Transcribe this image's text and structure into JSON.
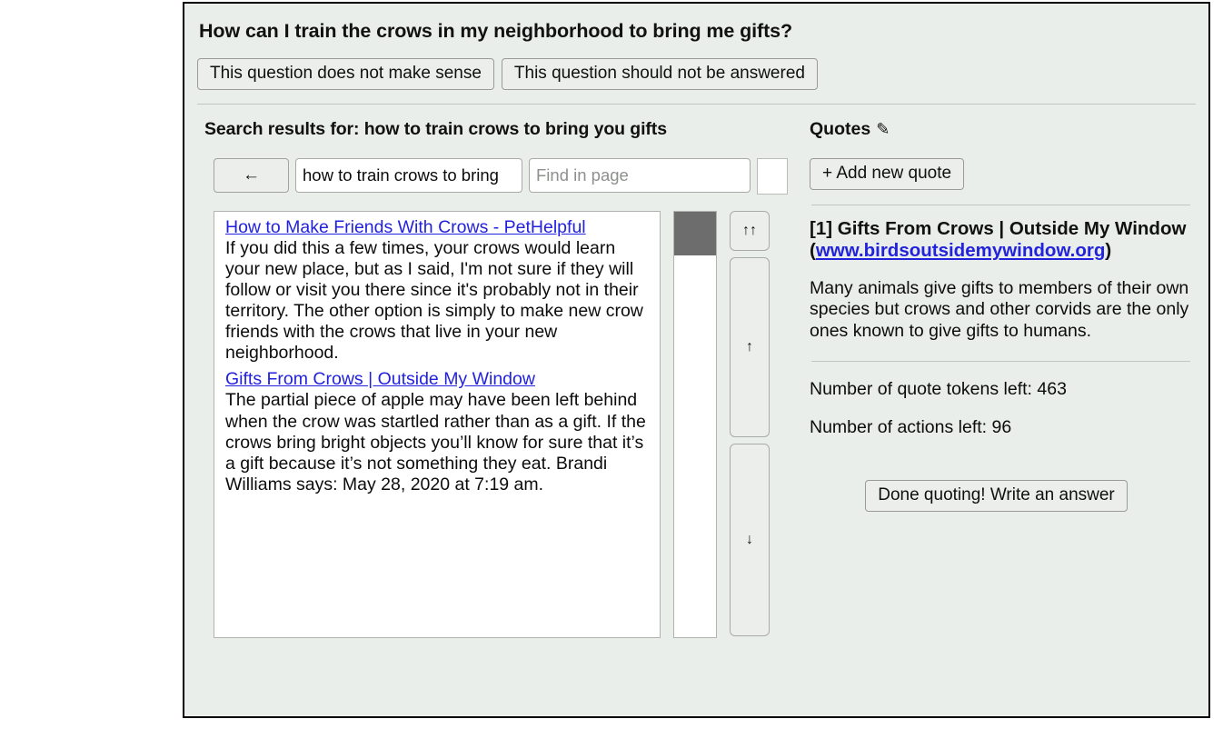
{
  "question": {
    "title": "How can I train the crows in my neighborhood to bring me gifts?",
    "flags": [
      "This question does not make sense",
      "This question should not be answered"
    ]
  },
  "search": {
    "results_header": "Search results for: how to train crows to bring you gifts",
    "back_label": "←",
    "query_value": "how to train crows to bring",
    "find_placeholder": "Find in page",
    "find_value": "",
    "results": [
      {
        "link": "How to Make Friends With Crows - PetHelpful",
        "snippet": "If you did this a few times, your crows would learn your new place, but as I said, I'm not sure if they will follow or visit you there since it's probably not in their territory. The other option is simply to make new crow friends with the crows that live in your new neighborhood."
      },
      {
        "link": "Gifts From Crows | Outside My Window",
        "snippet": "The partial piece of apple may have been left behind when the crow was startled rather than as a gift. If the crows bring bright objects you’ll know for sure that it’s a gift because it’s not something they eat. Brandi Williams says: May 28, 2020 at 7:19 am."
      }
    ],
    "nav": {
      "scroll_top": "↑↑",
      "scroll_up": "↑",
      "scroll_down": "↓"
    }
  },
  "quotes": {
    "header": "Quotes",
    "header_icon": "✎",
    "add_label": "+ Add new quote",
    "entry": {
      "index_title": "[1] Gifts From Crows | Outside My Window",
      "url_open": "(",
      "url": "www.birdsoutsidemywindow.org",
      "url_close": ")",
      "text": "Many animals give gifts to members of their own species but crows and other corvids are the only ones known to give gifts to humans."
    },
    "stats": {
      "tokens_left": "Number of quote tokens left: 463",
      "actions_left": "Number of actions left: 96"
    },
    "done_label": "Done quoting! Write an answer"
  },
  "colors": {
    "panel_bg": "#e9eeea",
    "link": "#2222dd",
    "scroll_thumb": "#6d6d6d",
    "button_bg": "#eceeec"
  }
}
